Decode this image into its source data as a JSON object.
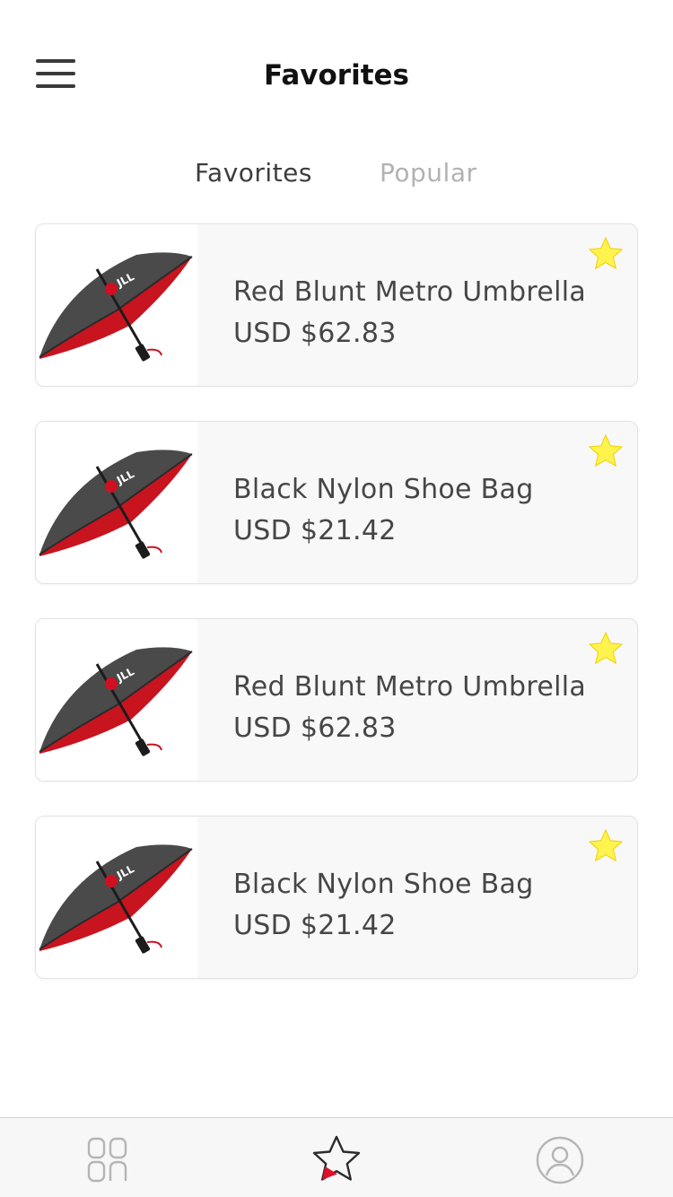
{
  "header": {
    "title": "Favorites",
    "menu_icon": "hamburger-menu-icon"
  },
  "tabs": [
    {
      "label": "Favorites",
      "active": true
    },
    {
      "label": "Popular",
      "active": false
    }
  ],
  "products": [
    {
      "name": "Red Blunt Metro Umbrella",
      "price": "USD $62.83",
      "favorited": true,
      "image": "umbrella-image"
    },
    {
      "name": "Black Nylon Shoe Bag",
      "price": "USD $21.42",
      "favorited": true,
      "image": "umbrella-image"
    },
    {
      "name": "Red Blunt Metro Umbrella",
      "price": "USD $62.83",
      "favorited": true,
      "image": "umbrella-image"
    },
    {
      "name": "Black Nylon Shoe Bag",
      "price": "USD $21.42",
      "favorited": true,
      "image": "umbrella-image"
    }
  ],
  "bottom_nav": [
    {
      "icon": "grid-icon",
      "active": false
    },
    {
      "icon": "star-icon",
      "active": true
    },
    {
      "icon": "profile-icon",
      "active": false
    }
  ],
  "colors": {
    "accent_red": "#e0102a",
    "star_yellow": "#fff34d",
    "text_dark": "#464646",
    "tab_inactive": "#b2b2b2"
  }
}
